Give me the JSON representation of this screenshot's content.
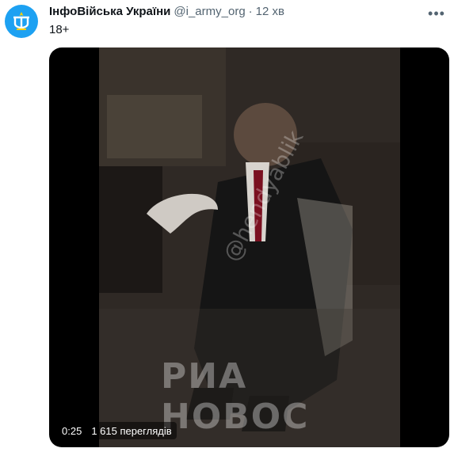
{
  "tweet": {
    "author_name": "ІнфоВійська України",
    "handle": "@i_army_org",
    "separator": "·",
    "time": "12 хв",
    "text": "18+",
    "more_icon": "more-horizontal-icon",
    "avatar_icon": "trident-icon",
    "colors": {
      "avatar_bg": "#1da1f2",
      "muted": "#536471"
    }
  },
  "media": {
    "elapsed": "0:25",
    "views": "1 615 переглядів",
    "watermark_main": "РИА НОВОС",
    "watermark_diag": "@hendyablik"
  }
}
